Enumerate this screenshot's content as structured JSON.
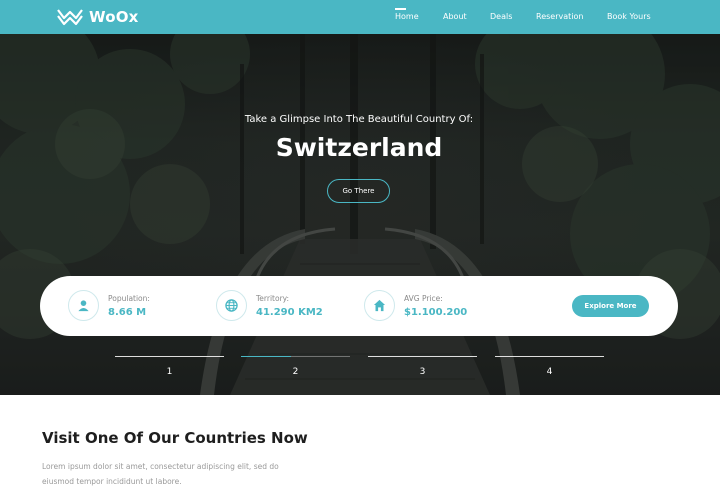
{
  "brand": {
    "name": "WoOx"
  },
  "nav": {
    "items": [
      {
        "label": "Home",
        "active": true
      },
      {
        "label": "About",
        "active": false
      },
      {
        "label": "Deals",
        "active": false
      },
      {
        "label": "Reservation",
        "active": false
      },
      {
        "label": "Book Yours",
        "active": false
      }
    ]
  },
  "hero": {
    "subtitle": "Take a Glimpse Into The Beautiful Country Of:",
    "title": "Switzerland",
    "button_label": "Go There"
  },
  "stats": [
    {
      "icon": "user-icon",
      "label": "Population:",
      "value": "8.66 M"
    },
    {
      "icon": "globe-icon",
      "label": "Territory:",
      "value": "41.290 KM2"
    },
    {
      "icon": "home-icon",
      "label": "AVG Price:",
      "value": "$1.100.200"
    }
  ],
  "explore_label": "Explore More",
  "slides": {
    "numbers": [
      "1",
      "2",
      "3",
      "4"
    ],
    "active_index": 1
  },
  "section": {
    "title": "Visit One Of Our Countries Now",
    "text": "Lorem ipsum dolor sit amet, consectetur adipiscing elit, sed do eiusmod tempor incididunt ut labore."
  },
  "colors": {
    "accent": "#4ab7c4",
    "header_bg": "#4ab7c4",
    "text_dark": "#1e1e1e",
    "text_muted": "#9a9a9a"
  }
}
